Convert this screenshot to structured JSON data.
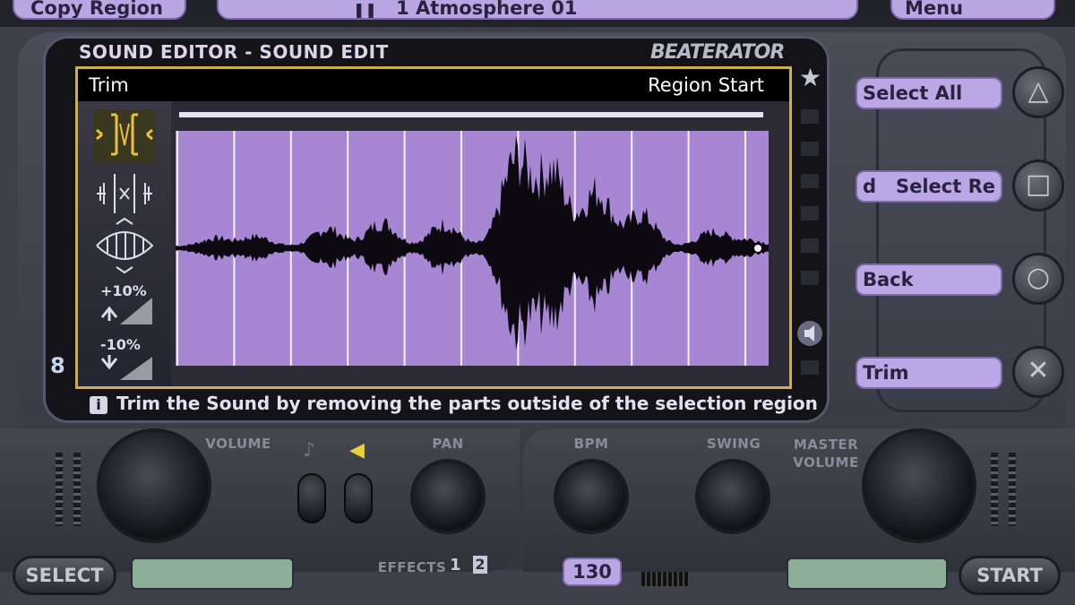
{
  "top": {
    "left_label": "Copy Region",
    "center_label": "1 Atmosphere 01",
    "center_icon": "play-pause-icon",
    "right_label": "Menu"
  },
  "editor": {
    "header": "SOUND EDITOR - SOUND EDIT",
    "logo": "BEATERATOR",
    "mode_label": "Trim",
    "region_label": "Region Start",
    "tool_plus_label": "+10%",
    "tool_minus_label": "-10%",
    "side_badge": "8",
    "help_text": "Trim the Sound by removing the parts outside of the selection region"
  },
  "actions": [
    {
      "label": "Select All",
      "button": "triangle-icon",
      "glyph": "△"
    },
    {
      "label": "d   Select Re",
      "button": "square-icon",
      "glyph": "□"
    },
    {
      "label": "Back",
      "button": "circle-icon",
      "glyph": "○"
    },
    {
      "label": "Trim",
      "button": "cross-icon",
      "glyph": "✕"
    }
  ],
  "deck": {
    "volume_label": "VOLUME",
    "pan_label": "PAN",
    "bpm_label": "BPM",
    "swing_label": "SWING",
    "master_label": "MASTER VOLUME",
    "effects_label": "EFFECTS",
    "effect_1": "1",
    "effect_2": "2",
    "bpm_value": "130",
    "select_label": "SELECT",
    "start_label": "START"
  },
  "colors": {
    "wave_bg": "#a787d4",
    "accent_purple": "#bba6e6",
    "frame_gold": "#c9b24a"
  }
}
